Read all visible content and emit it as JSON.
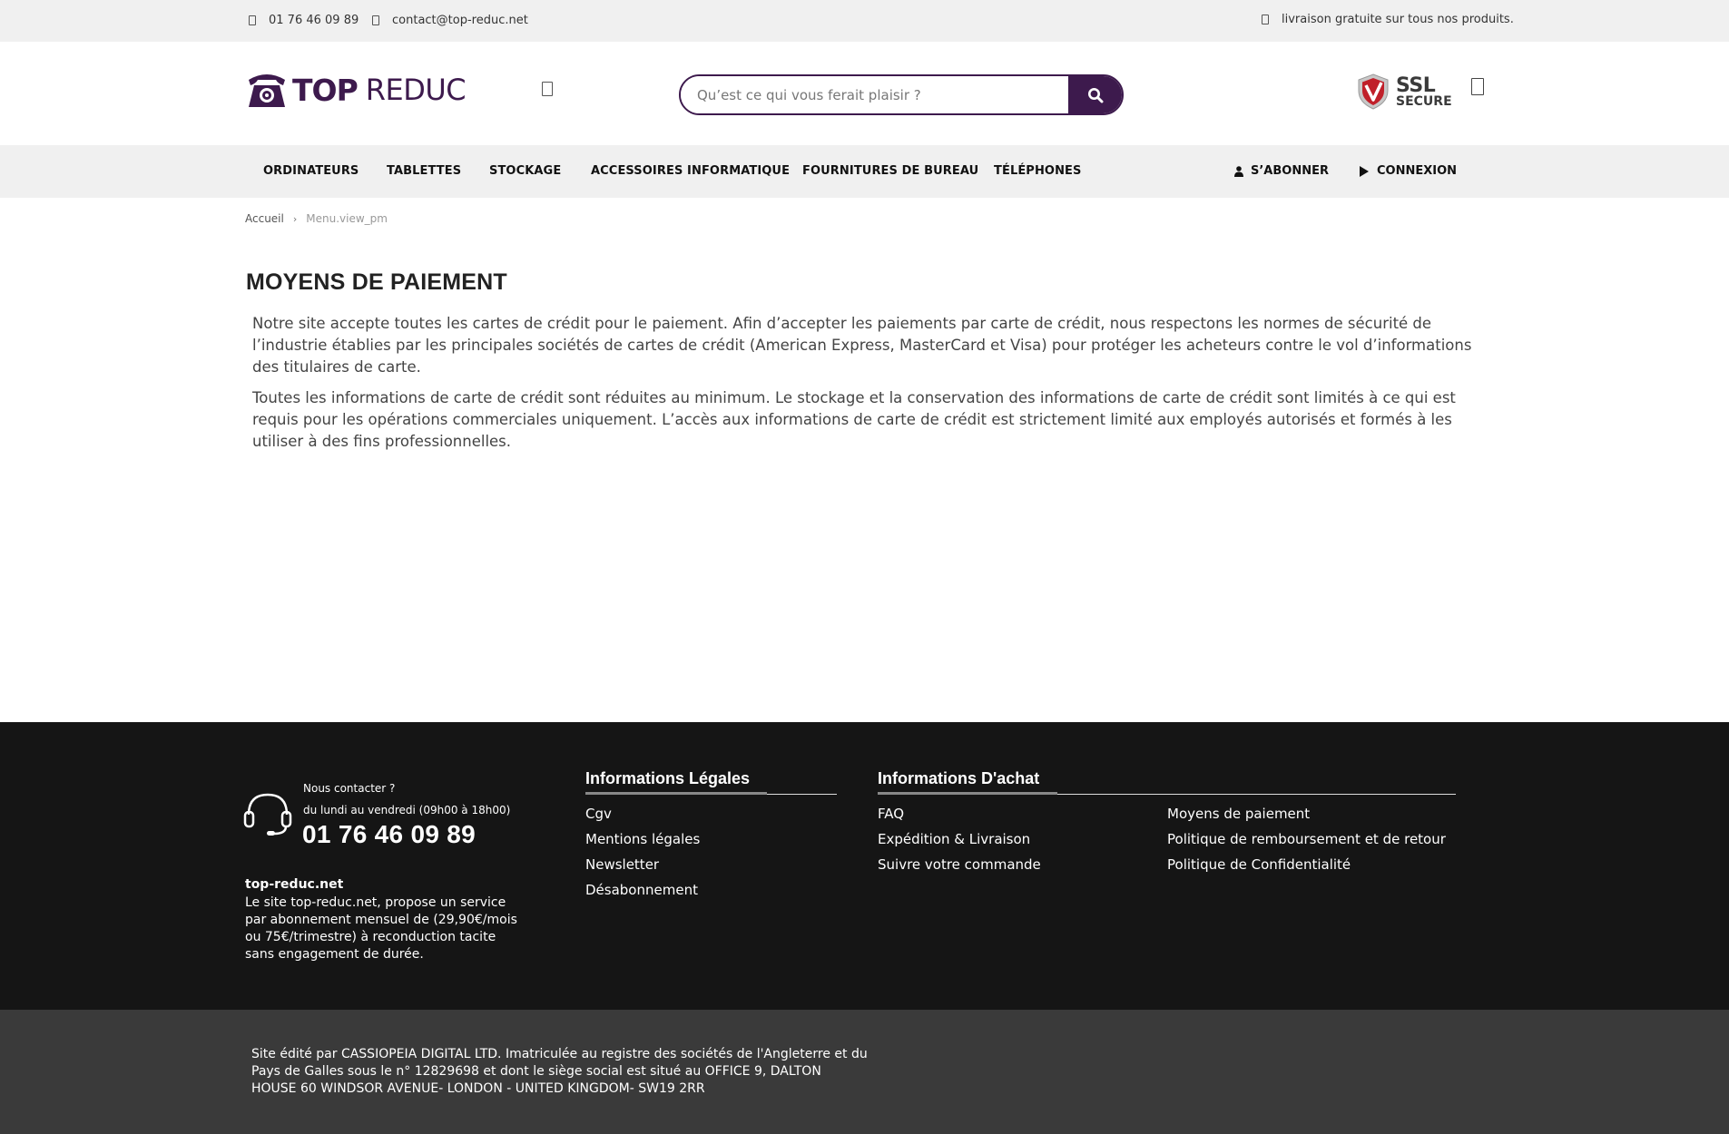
{
  "topbar": {
    "phone": "01 76 46 09 89",
    "email": "contact@top-reduc.net",
    "shipping": "livraison gratuite sur tous nos produits."
  },
  "header": {
    "logo_top": "TOP",
    "logo_reduc": "REDUC",
    "search_placeholder": "Qu’est ce qui vous ferait plaisir ?",
    "ssl_line1": "SSL",
    "ssl_line2": "SECURE"
  },
  "nav": {
    "items": [
      "ORDINATEURS",
      "TABLETTES",
      "STOCKAGE",
      "ACCESSOIRES INFORMATIQUE",
      "FOURNITURES DE BUREAU",
      "TÉLÉPHONES"
    ],
    "subscribe": "S’ABONNER",
    "login": "CONNEXION"
  },
  "breadcrumb": {
    "home": "Accueil",
    "current": "Menu.view_pm"
  },
  "main": {
    "title": "MOYENS DE PAIEMENT",
    "paragraphs": [
      "Notre site accepte toutes les cartes de crédit pour le paiement. Afin d’accepter les paiements par carte de crédit, nous respectons les normes de sécurité de l’industrie établies par les principales sociétés de cartes de crédit (American Express, MasterCard et Visa) pour protéger les acheteurs contre le vol d’informations des titulaires de carte.",
      "Toutes les informations de carte de crédit sont réduites au minimum. Le stockage et la conservation des informations de carte de crédit sont limités à ce qui est requis pour les opérations commerciales uniquement. L’accès aux informations de carte de crédit est strictement limité aux employés autorisés et formés à les utiliser à des fins professionnelles."
    ]
  },
  "footer": {
    "contact_question": "Nous contacter ?",
    "contact_hours": "du lundi au vendredi (09h00 à 18h00)",
    "contact_phone": "01 76 46 09 89",
    "site_name": "top-reduc.net",
    "site_desc": "Le site top-reduc.net, propose un service par abonnement mensuel de (29,90€/mois ou 75€/trimestre) à reconduction tacite sans engagement de durée.",
    "legal_title": "Informations Légales",
    "legal_links": [
      "Cgv",
      "Mentions légales",
      "Newsletter",
      "Désabonnement"
    ],
    "purchase_title": "Informations D'achat",
    "purchase_links_col1": [
      "FAQ",
      "Expédition & Livraison",
      "Suivre votre commande"
    ],
    "purchase_links_col2": [
      "Moyens de paiement",
      "Politique de remboursement et de retour",
      "Politique de Confidentialité"
    ]
  },
  "bottom": {
    "text": "Site édité par CASSIOPEIA DIGITAL LTD. Imatriculée au registre des sociétés de l'Angleterre et du Pays de Galles sous le n° 12829698 et dont le siège social est situé au OFFICE 9, DALTON HOUSE 60 WINDSOR AVENUE- LONDON - UNITED KINGDOM- SW19 2RR"
  },
  "colors": {
    "brand": "#3d1a4d",
    "footer_bg": "#151515",
    "bottom_bg": "#3a3a3a",
    "bar_bg": "#f0f0f0"
  }
}
